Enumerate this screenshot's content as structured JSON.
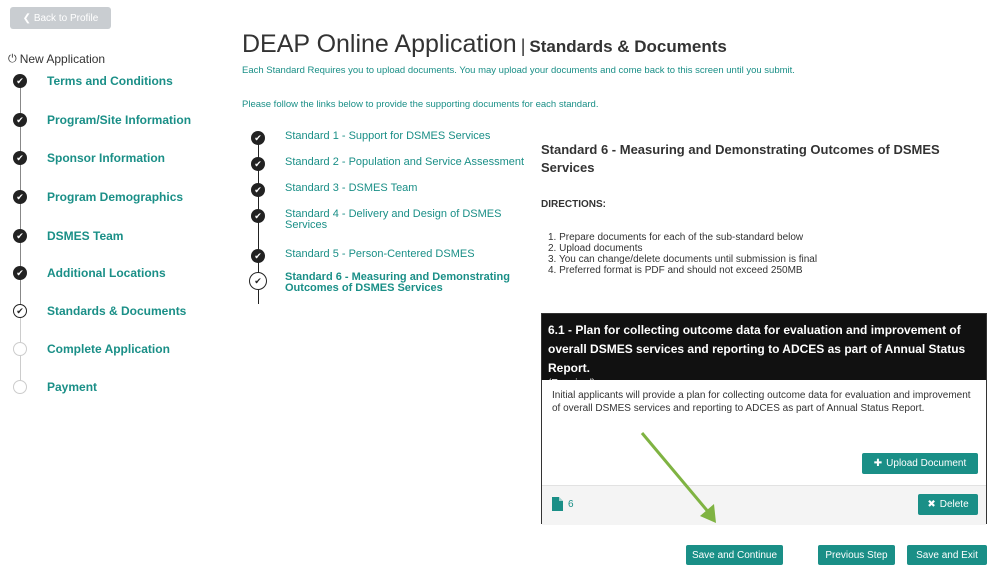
{
  "back": {
    "label": "❮ Back to Profile"
  },
  "sidebar": {
    "header": "New Application",
    "steps": [
      {
        "label": "Terms and Conditions",
        "status": "done"
      },
      {
        "label": "Program/Site Information",
        "status": "done"
      },
      {
        "label": "Sponsor Information",
        "status": "done"
      },
      {
        "label": "Program Demographics",
        "status": "done"
      },
      {
        "label": "DSMES Team",
        "status": "done"
      },
      {
        "label": "Additional Locations",
        "status": "done"
      },
      {
        "label": "Standards & Documents",
        "status": "current"
      },
      {
        "label": "Complete Application",
        "status": "todo"
      },
      {
        "label": "Payment",
        "status": "todo"
      }
    ]
  },
  "header": {
    "title": "DEAP Online Application",
    "separator": "|",
    "subtitle": "Standards & Documents",
    "intro1": "Each Standard Requires you to upload documents. You may upload your documents and come back to this screen until you submit.",
    "intro2": "Please follow the links below to provide the supporting documents for each standard."
  },
  "standards": [
    {
      "label": "Standard 1 - Support for DSMES Services"
    },
    {
      "label": "Standard 2 - Population and Service Assessment"
    },
    {
      "label": "Standard 3 - DSMES Team"
    },
    {
      "label": "Standard 4 - Delivery and Design of DSMES Services"
    },
    {
      "label": "Standard 5 - Person-Centered DSMES"
    },
    {
      "label": "Standard 6 - Measuring and Demonstrating Outcomes of DSMES Services"
    }
  ],
  "detail": {
    "title": "Standard 6 - Measuring and Demonstrating Outcomes of DSMES Services",
    "directions_label": "DIRECTIONS:",
    "directions": [
      "1. Prepare documents for each of the sub-standard below",
      "2. Upload documents",
      "3. You can change/delete documents until submission is final",
      "4. Preferred format is PDF and should not exceed 250MB"
    ],
    "sub": {
      "heading": "6.1 - Plan for collecting outcome data for evaluation and improvement of overall DSMES services and reporting to ADCES as part of Annual Status Report.",
      "required": "(Required)",
      "description": "Initial applicants will provide a plan for collecting outcome data for evaluation and improvement of overall DSMES services and reporting to ADCES as part of Annual Status Report.",
      "upload_label": "Upload Document",
      "file_name": "6",
      "delete_label": "Delete"
    }
  },
  "actions": {
    "save_continue": "Save and Continue",
    "previous_step": "Previous Step",
    "save_exit": "Save and Exit"
  },
  "colors": {
    "accent": "#1a8f87",
    "arrow": "#7fb342"
  }
}
